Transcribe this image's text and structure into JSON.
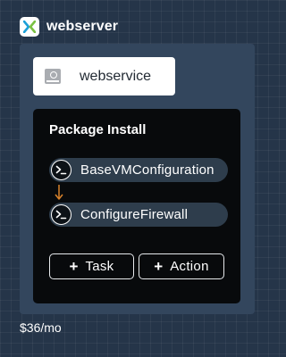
{
  "header": {
    "title": "webserver",
    "logo_icon": "x-logo-icon"
  },
  "service": {
    "label": "webservice",
    "icon": "server-icon"
  },
  "package": {
    "title": "Package Install",
    "steps": [
      {
        "label": "BaseVMConfiguration",
        "icon": "terminal-icon"
      },
      {
        "label": "ConfigureFirewall",
        "icon": "terminal-icon"
      }
    ],
    "connector_icon": "arrow-down-icon"
  },
  "buttons": {
    "task_label": "Task",
    "action_label": "Action",
    "plus_symbol": "+"
  },
  "cost": "$36/mo",
  "colors": {
    "background": "#253549",
    "panel": "#33465d",
    "package_panel": "#080a0c",
    "step_pill": "#2e3d4c",
    "connector": "#d9822b",
    "logo_blue": "#1ca0d8",
    "logo_green": "#7ac143"
  }
}
